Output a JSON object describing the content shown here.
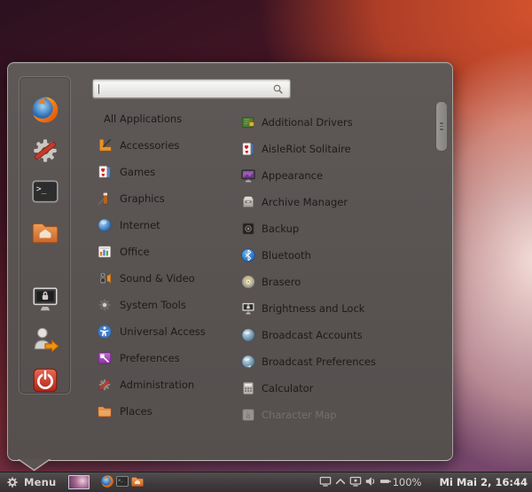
{
  "menu": {
    "search": {
      "value": ""
    },
    "favorites": [
      {
        "name": "firefox"
      },
      {
        "name": "system-settings"
      },
      {
        "name": "terminal"
      },
      {
        "name": "home-folder"
      },
      {
        "name": "lock-screen"
      },
      {
        "name": "logout"
      },
      {
        "name": "shutdown"
      }
    ],
    "categories": [
      {
        "label": "All Applications",
        "icon": ""
      },
      {
        "label": "Accessories",
        "icon": "accessories"
      },
      {
        "label": "Games",
        "icon": "games"
      },
      {
        "label": "Graphics",
        "icon": "graphics"
      },
      {
        "label": "Internet",
        "icon": "internet"
      },
      {
        "label": "Office",
        "icon": "office"
      },
      {
        "label": "Sound & Video",
        "icon": "sound-video"
      },
      {
        "label": "System Tools",
        "icon": "system-tools"
      },
      {
        "label": "Universal Access",
        "icon": "universal-access"
      },
      {
        "label": "Preferences",
        "icon": "preferences"
      },
      {
        "label": "Administration",
        "icon": "administration"
      },
      {
        "label": "Places",
        "icon": "places"
      }
    ],
    "applications": [
      {
        "label": "Additional Drivers",
        "icon": "additional-drivers",
        "enabled": true
      },
      {
        "label": "AisleRiot Solitaire",
        "icon": "aisleriot-solitaire",
        "enabled": true
      },
      {
        "label": "Appearance",
        "icon": "appearance",
        "enabled": true
      },
      {
        "label": "Archive Manager",
        "icon": "archive-manager",
        "enabled": true
      },
      {
        "label": "Backup",
        "icon": "backup",
        "enabled": true
      },
      {
        "label": "Bluetooth",
        "icon": "bluetooth",
        "enabled": true
      },
      {
        "label": "Brasero",
        "icon": "brasero",
        "enabled": true
      },
      {
        "label": "Brightness and Lock",
        "icon": "brightness-and-lock",
        "enabled": true
      },
      {
        "label": "Broadcast Accounts",
        "icon": "broadcast-accounts",
        "enabled": true
      },
      {
        "label": "Broadcast Preferences",
        "icon": "broadcast-preferences",
        "enabled": true
      },
      {
        "label": "Calculator",
        "icon": "calculator",
        "enabled": true
      },
      {
        "label": "Character Map",
        "icon": "character-map",
        "enabled": false
      }
    ]
  },
  "panel": {
    "menu_button_label": "Menu",
    "launchers": [
      {
        "name": "window-thumbnail"
      },
      {
        "name": "firefox"
      },
      {
        "name": "terminal"
      },
      {
        "name": "home-folder"
      }
    ],
    "tray": [
      {
        "name": "display"
      },
      {
        "name": "chevron-up"
      },
      {
        "name": "remote-display"
      },
      {
        "name": "volume"
      },
      {
        "name": "battery"
      }
    ],
    "battery_label": "100%",
    "clock": "Mi Mai 2, 16:44"
  },
  "colors": {
    "menu_bg": "#595352",
    "panel_bg": "#403c3d",
    "accent_orange": "#dd4814",
    "item_text": "#1c1b1a",
    "panel_text": "#d8d5d2"
  }
}
